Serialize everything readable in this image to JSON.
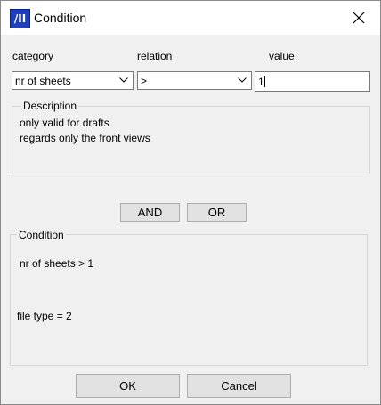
{
  "window": {
    "title": "Condition",
    "icon_text": "/II",
    "close_icon": "close-icon",
    "accent_color": "#1f3fbf"
  },
  "fields": {
    "category_label": "category",
    "relation_label": "relation",
    "value_label": "value",
    "category_value": "nr of sheets",
    "relation_value": ">",
    "value_value": "1"
  },
  "description": {
    "legend": "Description",
    "lines": [
      "only valid for drafts",
      "regards only the front views"
    ]
  },
  "logic_buttons": {
    "and_label": "AND",
    "or_label": "OR"
  },
  "condition": {
    "legend": "Condition",
    "lines": [
      "nr of sheets > 1",
      "file type = 2"
    ]
  },
  "footer": {
    "ok_label": "OK",
    "cancel_label": "Cancel"
  }
}
